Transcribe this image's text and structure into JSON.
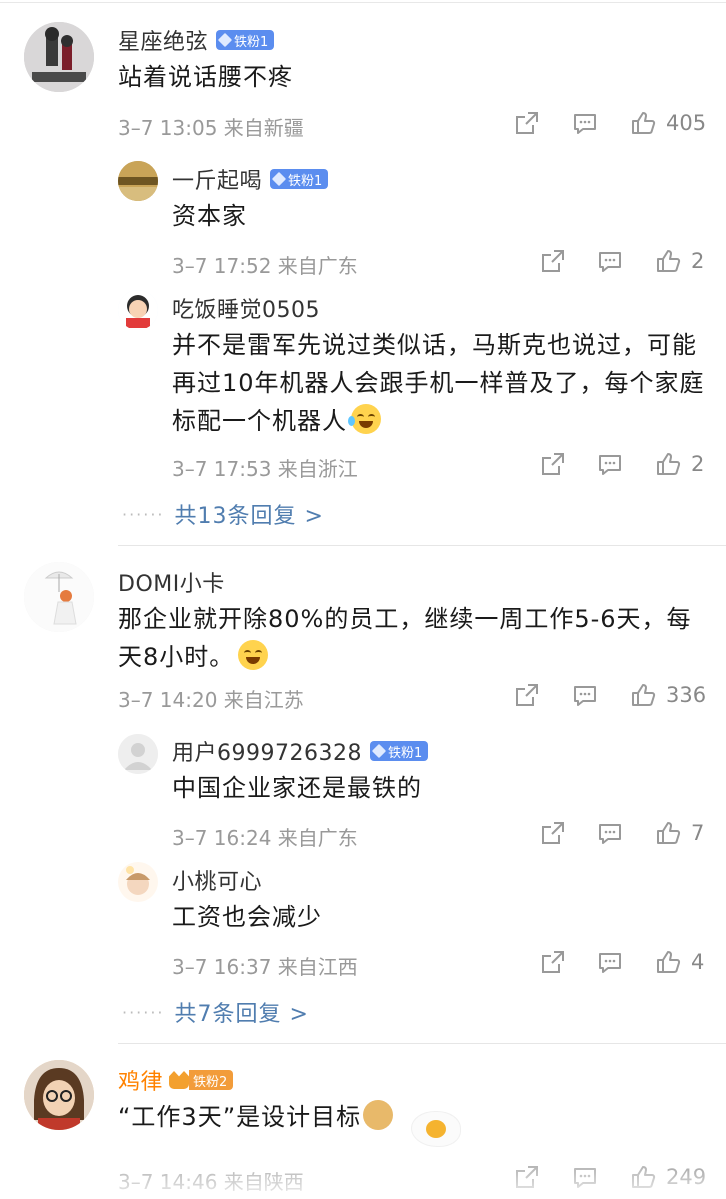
{
  "comments": [
    {
      "name": "星座绝弦",
      "badge": "铁粉1",
      "text": "站着说话腰不疼",
      "meta": "3–7 13:05 来自新疆",
      "likes": "405",
      "replies": [
        {
          "name": "一斤起喝",
          "badge": "铁粉1",
          "text": "资本家",
          "meta": "3–7 17:52 来自广东",
          "likes": "2"
        },
        {
          "name": "吃饭睡觉0505",
          "badge": "",
          "text": "并不是雷军先说过类似话，马斯克也说过，可能再过10年机器人会跟手机一样普及了，每个家庭标配一个机器人",
          "meta": "3–7 17:53 来自浙江",
          "likes": "2"
        }
      ],
      "more": "共13条回复 >"
    },
    {
      "name": "DOMI小卡",
      "badge": "",
      "text": "那企业就开除80%的员工，继续一周工作5-6天，每天8小时。",
      "meta": "3–7 14:20 来自江苏",
      "likes": "336",
      "replies": [
        {
          "name": "用户6999726328",
          "badge": "铁粉1",
          "text": "中国企业家还是最铁的",
          "meta": "3–7 16:24 来自广东",
          "likes": "7"
        },
        {
          "name": "小桃可心",
          "badge": "",
          "text": "工资也会减少",
          "meta": "3–7 16:37 来自江西",
          "likes": "4"
        }
      ],
      "more": "共7条回复 >"
    },
    {
      "name": "鸡律",
      "badge": "铁粉2",
      "text": "“工作3天”是设计目标",
      "meta": "3–7 14:46 来自陕西",
      "likes": "249"
    }
  ],
  "icons": {
    "share": "share-icon",
    "comment": "comment-icon",
    "like": "like-icon"
  },
  "colors": {
    "link": "#507daf",
    "badge": "#5b8def",
    "badge_gold": "#f29c3a",
    "name_vip": "#ff8200",
    "meta": "#999999"
  }
}
